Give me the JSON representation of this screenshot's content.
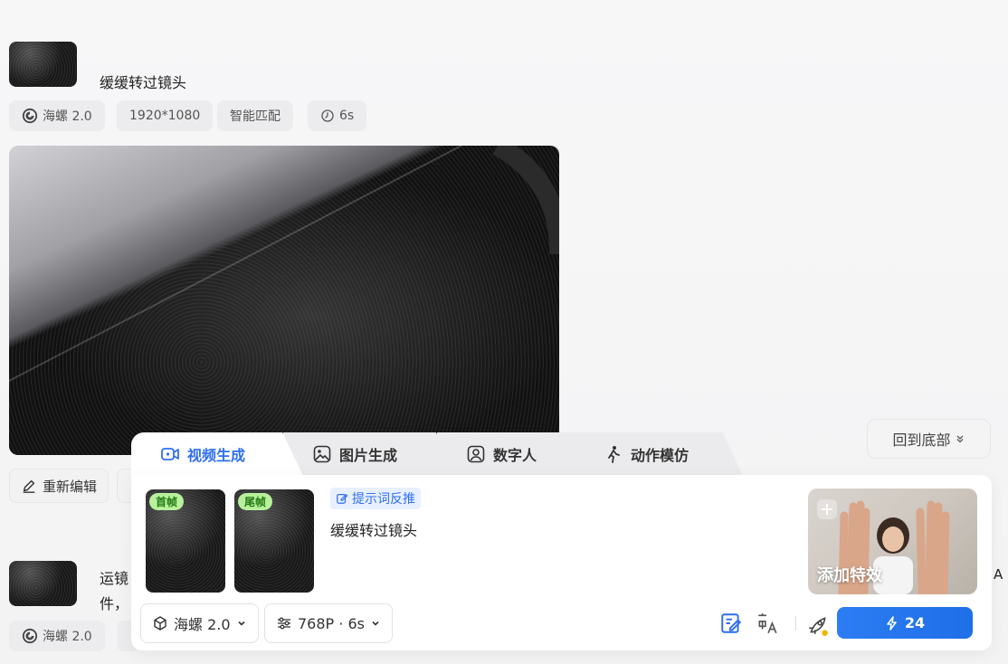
{
  "message1": {
    "prompt": "缓缓转过镜头",
    "chips": {
      "model": "海螺 2.0",
      "resolution": "1920*1080",
      "mode": "智能匹配",
      "duration": "6s"
    },
    "edit_button": "重新编辑"
  },
  "message2": {
    "prompt_line1": "运镜",
    "prompt_line2": "件，",
    "model_chip": "海螺 2.0",
    "overflow_text": "A"
  },
  "back_to_bottom": "回到底部",
  "composer": {
    "tabs": [
      {
        "label": "视频生成",
        "icon": "video-icon",
        "active": true
      },
      {
        "label": "图片生成",
        "icon": "image-icon",
        "active": false
      },
      {
        "label": "数字人",
        "icon": "avatar-icon",
        "active": false
      },
      {
        "label": "动作模仿",
        "icon": "walking-person-icon",
        "active": false
      }
    ],
    "first_frame_badge": "首帧",
    "last_frame_badge": "尾帧",
    "reverse_prompt_label": "提示词反推",
    "prompt_text": "缓缓转过镜头",
    "add_effect_label": "添加特效",
    "model_select": "海螺 2.0",
    "settings_select": "768P · 6s",
    "generate_cost": "24"
  },
  "colors": {
    "accent": "#2f6ff0",
    "badge_bg": "#b9f09c",
    "generate_bg": "#1e6fe8"
  }
}
